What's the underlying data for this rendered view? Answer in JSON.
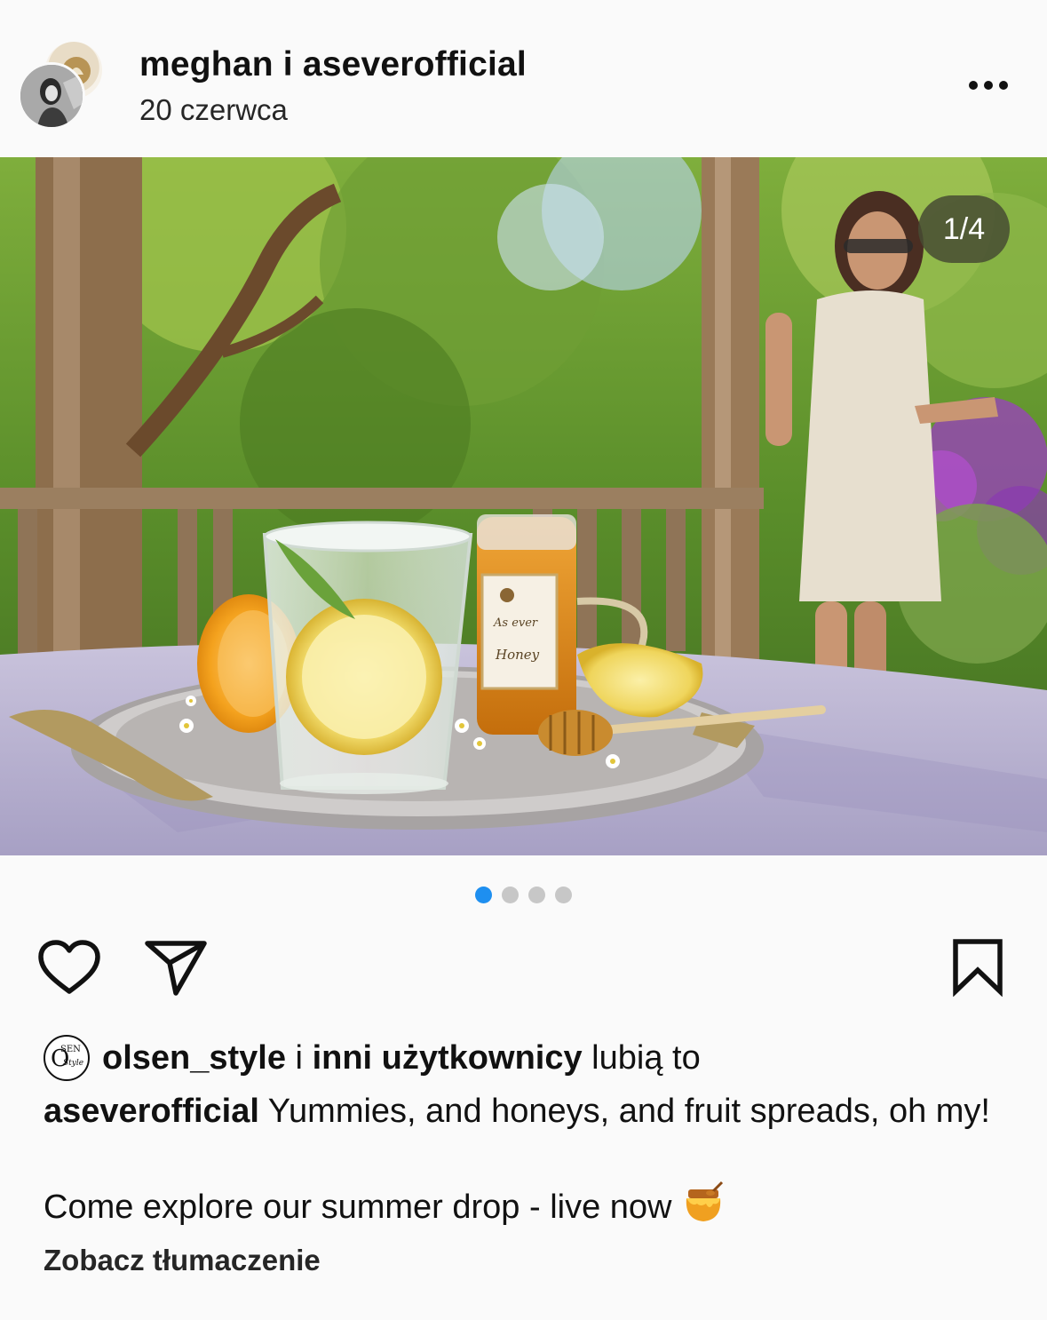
{
  "post": {
    "authors": "meghan i aseverofficial",
    "date": "20 czerwca",
    "more_icon": "more-horizontal-icon",
    "carousel": {
      "current": 1,
      "total": 4,
      "counter_label": "1/4"
    },
    "jar_label": {
      "line1": "As ever",
      "line2": "Honey"
    }
  },
  "likes": {
    "avatar_text_1": "O",
    "avatar_text_2": "SEN",
    "avatar_text_3": "Style",
    "user": "olsen_style",
    "connector": " i ",
    "others": "inni użytkownicy",
    "suffix": " lubią to"
  },
  "caption": {
    "username": "aseverofficial",
    "text_line1": " Yummies, and honeys, and fruit spreads, oh my!",
    "text_line2": "Come explore our summer drop - live now",
    "emoji": "honey-pot-icon"
  },
  "translate_label": "Zobacz tłumaczenie",
  "colors": {
    "accent_dot": "#1e8ff0",
    "inactive_dot": "#c7c7c7",
    "text": "#111111"
  }
}
